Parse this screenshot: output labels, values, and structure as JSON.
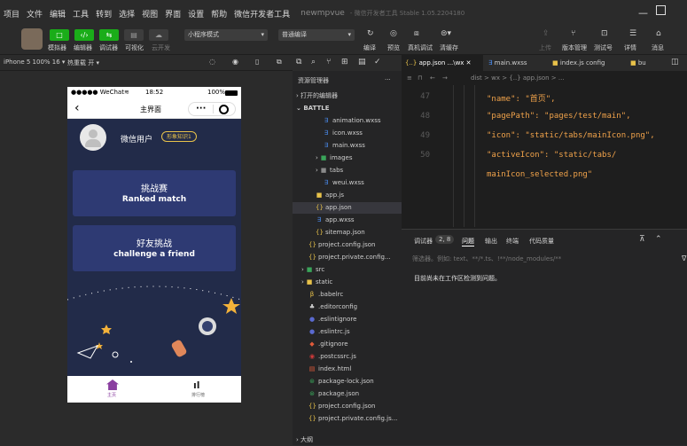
{
  "menu": {
    "items": [
      "项目",
      "文件",
      "编辑",
      "工具",
      "转到",
      "选择",
      "视图",
      "界面",
      "设置",
      "帮助",
      "微信开发者工具"
    ],
    "project": "newmpvue",
    "version": "- 微信开发者工具 Stable 1.05.2204180"
  },
  "toolbar": {
    "left_labels": [
      "模拟器",
      "编辑器",
      "调试器",
      "可视化",
      "云开发"
    ],
    "mode": "小程序模式",
    "compile": "普通编译",
    "mid_labels": [
      "编译",
      "预览",
      "真机调试",
      "清缓存"
    ],
    "right_labels": [
      "上传",
      "版本管理",
      "测试号",
      "详情",
      "消息"
    ]
  },
  "simulator": {
    "device": "iPhone 5 100% 16 ▾",
    "hotreload": "热重载 开 ▾",
    "status": {
      "carrier": "●●●●● WeChat",
      "wifi": "≋",
      "time": "18:52",
      "battery": "100%"
    },
    "nav_title": "主界面",
    "user_name": "微信用户",
    "badge": "形象知识1",
    "card1": {
      "cn": "挑战赛",
      "en": "Ranked match"
    },
    "card2": {
      "cn": "好友挑战",
      "en": "challenge a friend"
    },
    "tab1": "主页",
    "tab2": "排行榜"
  },
  "explorer": {
    "title": "资源管理器",
    "more": "···",
    "open_editors": "打开的编辑器",
    "root": "BATTLE",
    "files": [
      {
        "name": "animation.wxss",
        "icon": "wxss"
      },
      {
        "name": "icon.wxss",
        "icon": "wxss"
      },
      {
        "name": "main.wxss",
        "icon": "wxss"
      },
      {
        "name": "images",
        "icon": "folder-img"
      },
      {
        "name": "tabs",
        "icon": "folder"
      },
      {
        "name": "weui.wxss",
        "icon": "wxss"
      },
      {
        "name": "app.js",
        "icon": "js"
      },
      {
        "name": "app.json",
        "icon": "json"
      },
      {
        "name": "app.wxss",
        "icon": "wxss"
      },
      {
        "name": "sitemap.json",
        "icon": "json"
      },
      {
        "name": "project.config.json",
        "icon": "json"
      },
      {
        "name": "project.private.config...",
        "icon": "json"
      },
      {
        "name": "src",
        "icon": "folder-src"
      },
      {
        "name": "static",
        "icon": "folder-static"
      },
      {
        "name": ".babelrc",
        "icon": "babel"
      },
      {
        "name": ".editorconfig",
        "icon": "config"
      },
      {
        "name": ".eslintignore",
        "icon": "eslint"
      },
      {
        "name": ".eslintrc.js",
        "icon": "eslint"
      },
      {
        "name": ".gitignore",
        "icon": "git"
      },
      {
        "name": ".postcssrc.js",
        "icon": "postcss"
      },
      {
        "name": "index.html",
        "icon": "html"
      },
      {
        "name": "package-lock.json",
        "icon": "npm"
      },
      {
        "name": "package.json",
        "icon": "npm"
      },
      {
        "name": "project.config.json",
        "icon": "json"
      },
      {
        "name": "project.private.config.js...",
        "icon": "json"
      }
    ],
    "outline": "大纲"
  },
  "editor": {
    "tabs": [
      "app.json ...\\wx ✕",
      "main.wxss",
      "index.js config",
      "bu"
    ],
    "breadcrumb": "dist > wx > {..} app.json > ...",
    "lines": [
      {
        "n": "47",
        "text": "\"name\": \"首页\","
      },
      {
        "n": "48",
        "text": "\"pagePath\": \"pages/test/main\","
      },
      {
        "n": "49",
        "text": "\"icon\": \"static/tabs/mainIcon.png\","
      },
      {
        "n": "50",
        "text": "\"activeIcon\": \"static/tabs/"
      },
      {
        "n": "",
        "text": "mainIcon_selected.png\""
      }
    ],
    "panel_tabs": [
      "调试器",
      "2, 8",
      "问题",
      "输出",
      "终端",
      "代码质量"
    ],
    "filter_placeholder": "筛选器。例如: text、**/*.ts、!**/node_modules/**",
    "problem_msg": "目前尚未在工作区检测到问题。"
  }
}
